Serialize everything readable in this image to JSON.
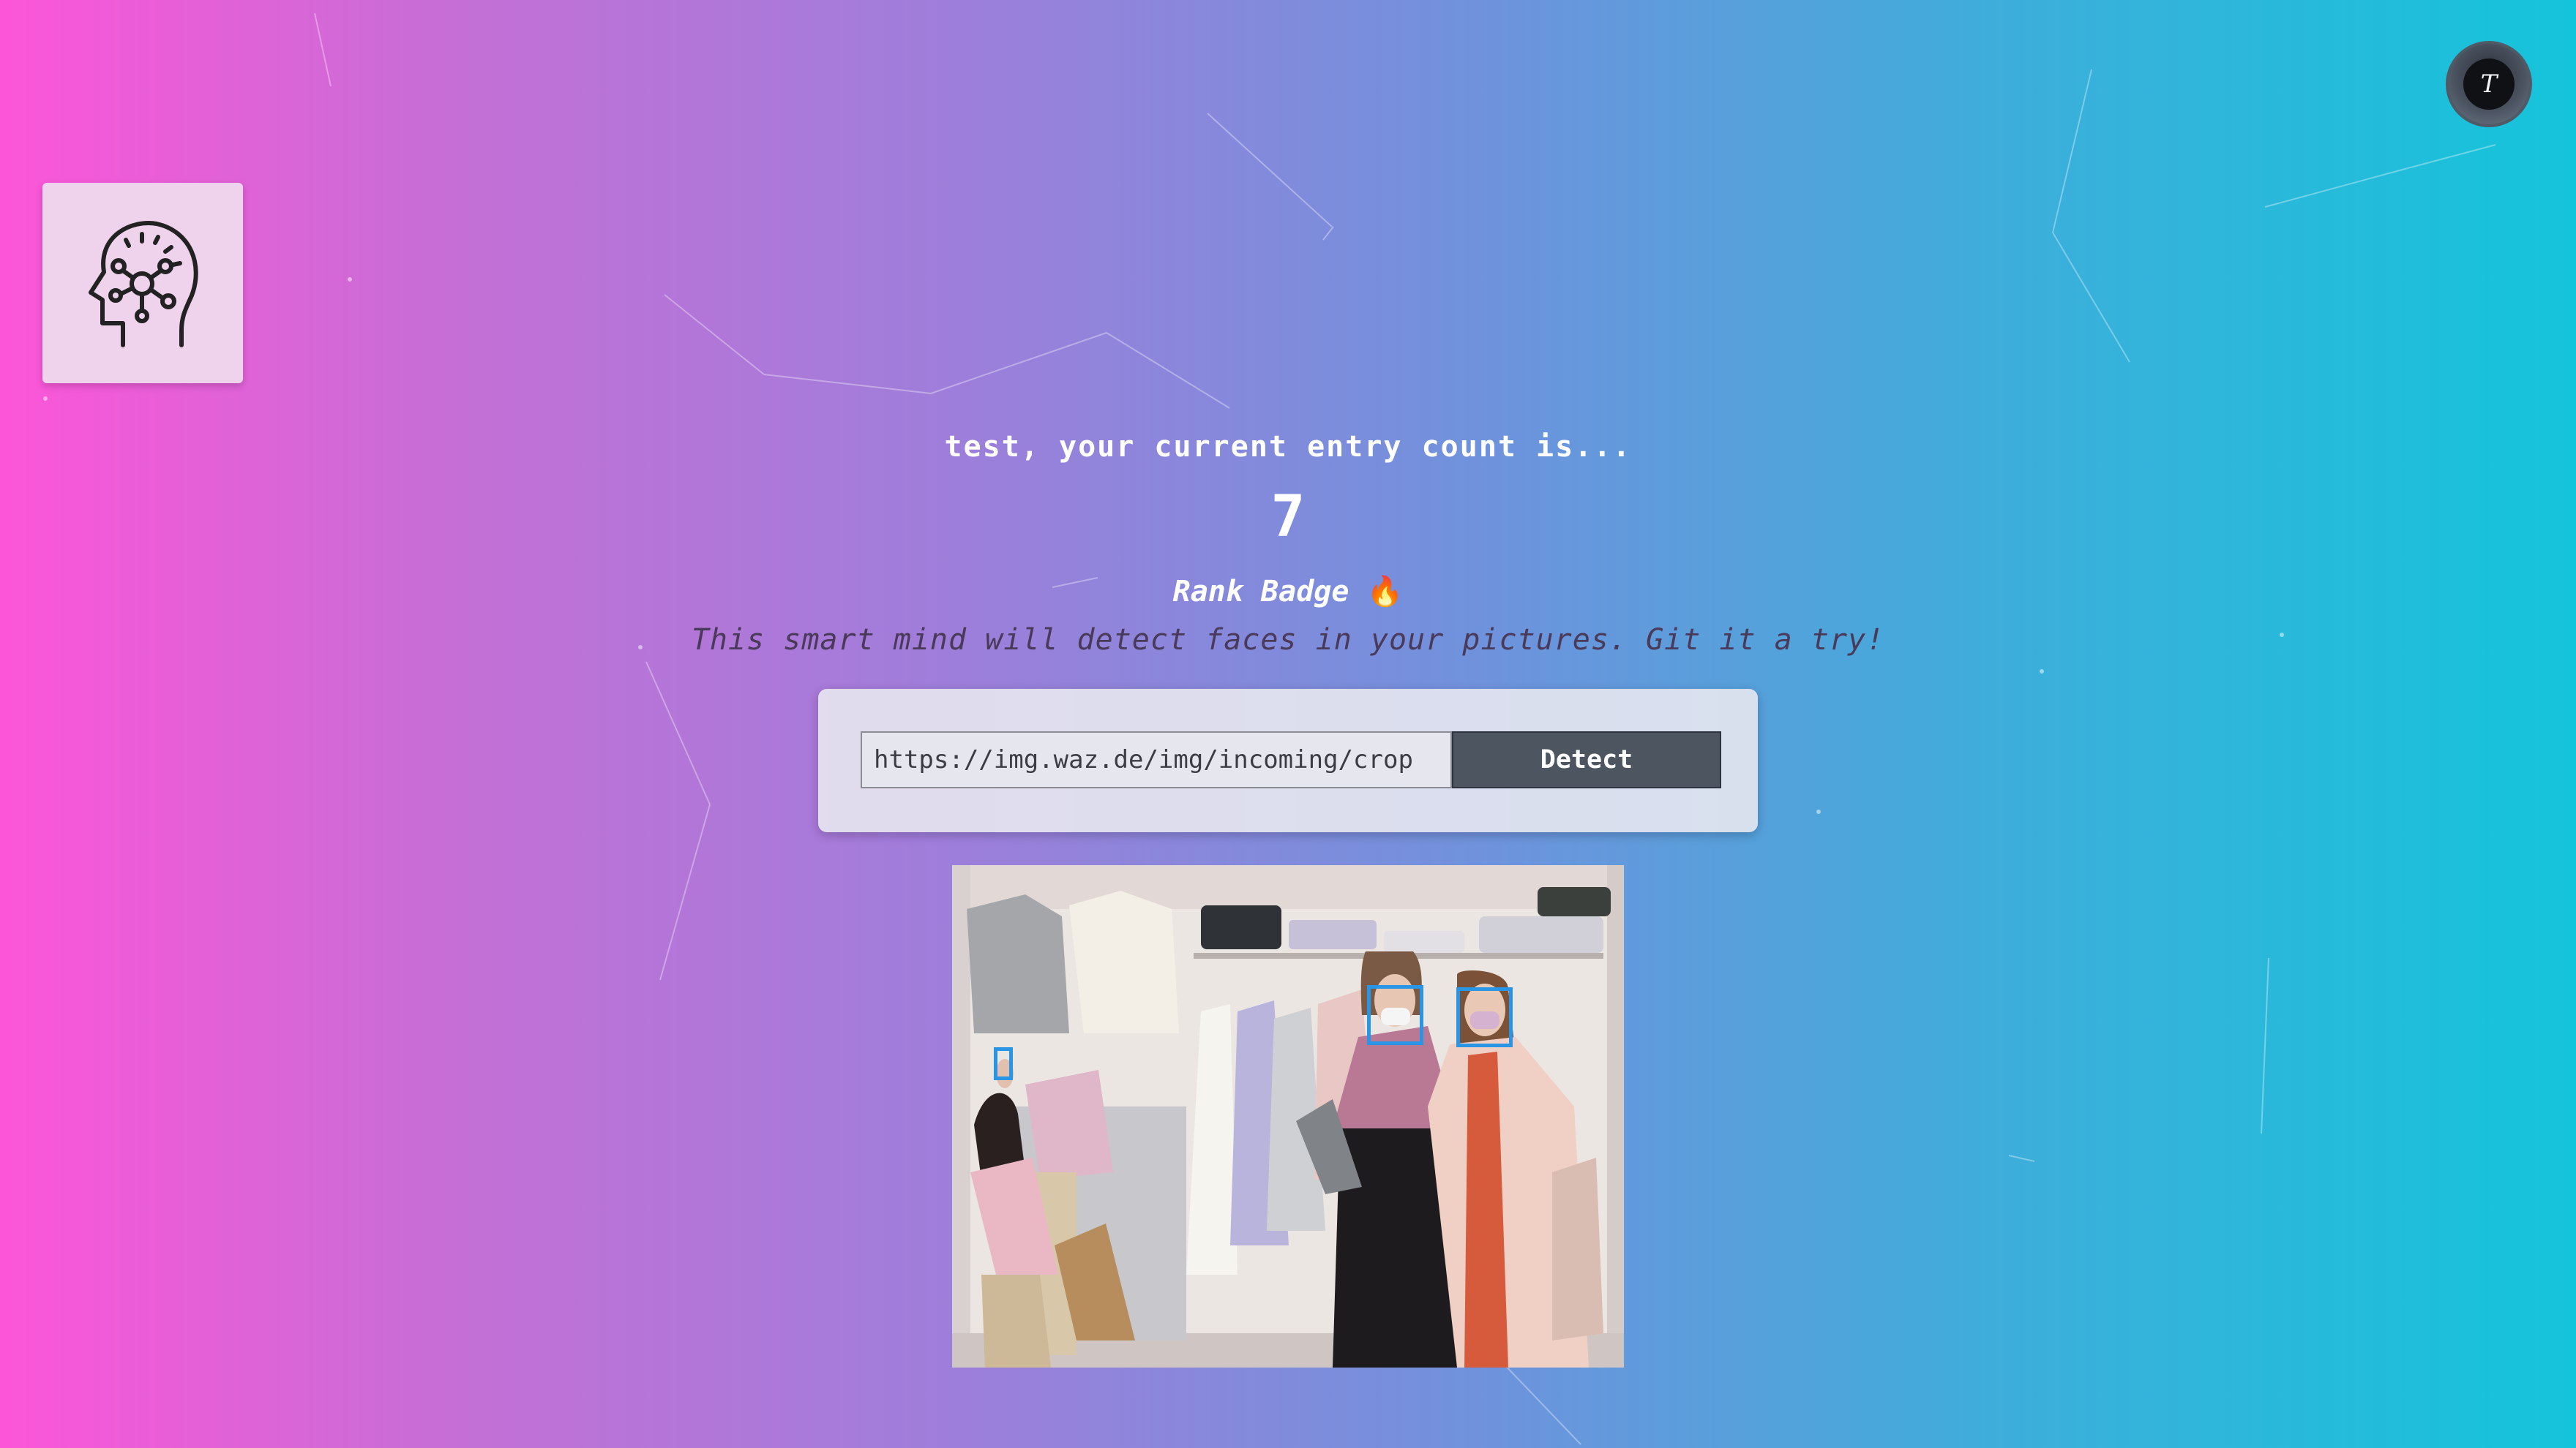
{
  "user": {
    "avatar_initial": "T",
    "greeting": "test, your current entry count is...",
    "entry_count": "7"
  },
  "rank": {
    "label": "Rank Badge",
    "emoji": "🔥"
  },
  "tagline": "This smart mind will detect faces in your pictures. Git it a try!",
  "form": {
    "url_value": "https://img.waz.de/img/incoming/crop",
    "detect_label": "Detect"
  },
  "icons": {
    "logo": "brain-network-icon",
    "avatar": "user-avatar",
    "rank": "fire-emoji"
  },
  "colors": {
    "gradient_start": "#fc55d8",
    "gradient_end": "#14c4da",
    "face_box": "#2b95e5",
    "button": "#4d5560"
  },
  "detection": {
    "faces_detected_count": 3
  }
}
